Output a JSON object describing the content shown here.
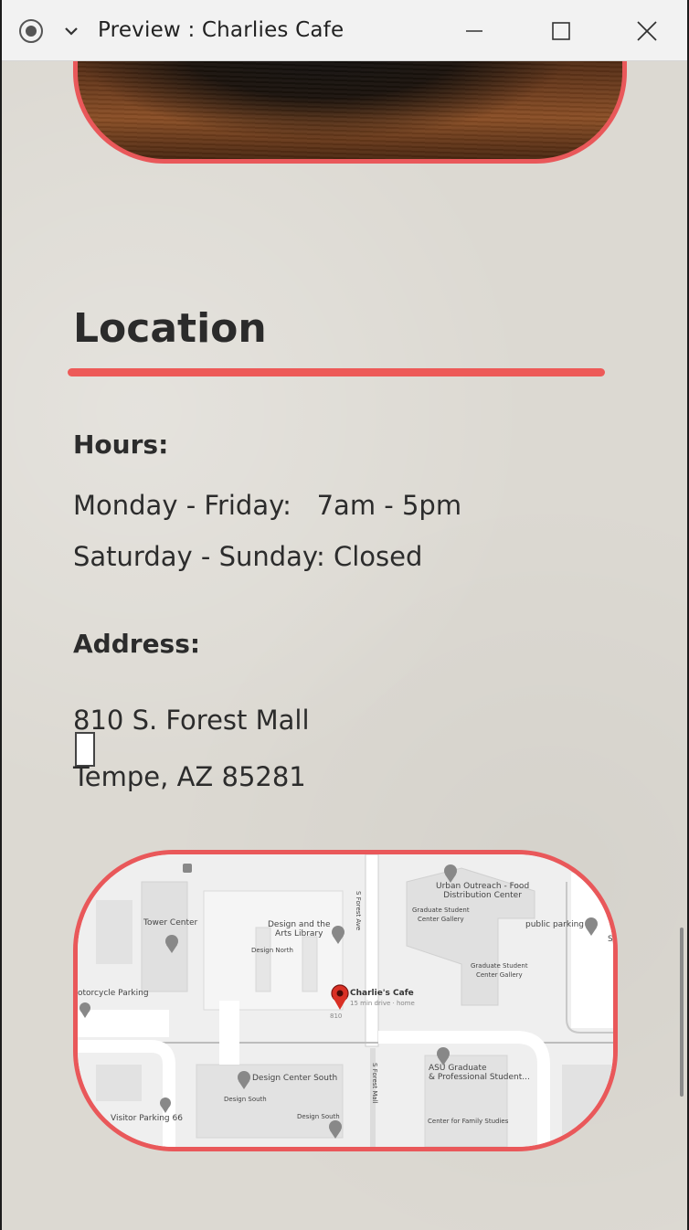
{
  "window": {
    "title": "Preview : Charlies Cafe"
  },
  "location": {
    "heading": "Location",
    "hours_label": "Hours:",
    "hours": [
      "Monday - Friday:   7am - 5pm",
      "Saturday - Sunday: Closed"
    ],
    "address_label": "Address:",
    "address": [
      "810 S. Forest Mall",
      "Tempe, AZ 85281"
    ]
  },
  "map": {
    "labels": {
      "tower_center": "Tower Center",
      "design_arts_library": "Design and the\nArts Library",
      "design_north": "Design North",
      "s_forest_ave": "S Forest Ave",
      "urban_outreach": "Urban Outreach - Food\nDistribution Center",
      "grad_student_center_gallery_1": "Graduate Student\nCenter Gallery",
      "public_parking": "public parking",
      "grad_student_center_gallery_2": "Graduate Student\nCenter Gallery",
      "motorcycle_parking": "otorcycle Parking",
      "charlies_cafe": "Charlie's Cafe",
      "charlies_cafe_sub": "15 min drive · home",
      "num_810": "810",
      "design_center_south": "Design Center South",
      "design_south_1": "Design South",
      "design_south_2": "Design South",
      "s_forest_mall": "S Forest Mall",
      "asu_graduate": "ASU Graduate\n& Professional Student...",
      "center_family": "Center for Family Studies",
      "visitor_parking": "Visitor Parking 66",
      "edge_s": "S"
    }
  },
  "colors": {
    "accent": "#ed5a58",
    "background": "#dcd9d2",
    "text": "#2c2c2c"
  }
}
